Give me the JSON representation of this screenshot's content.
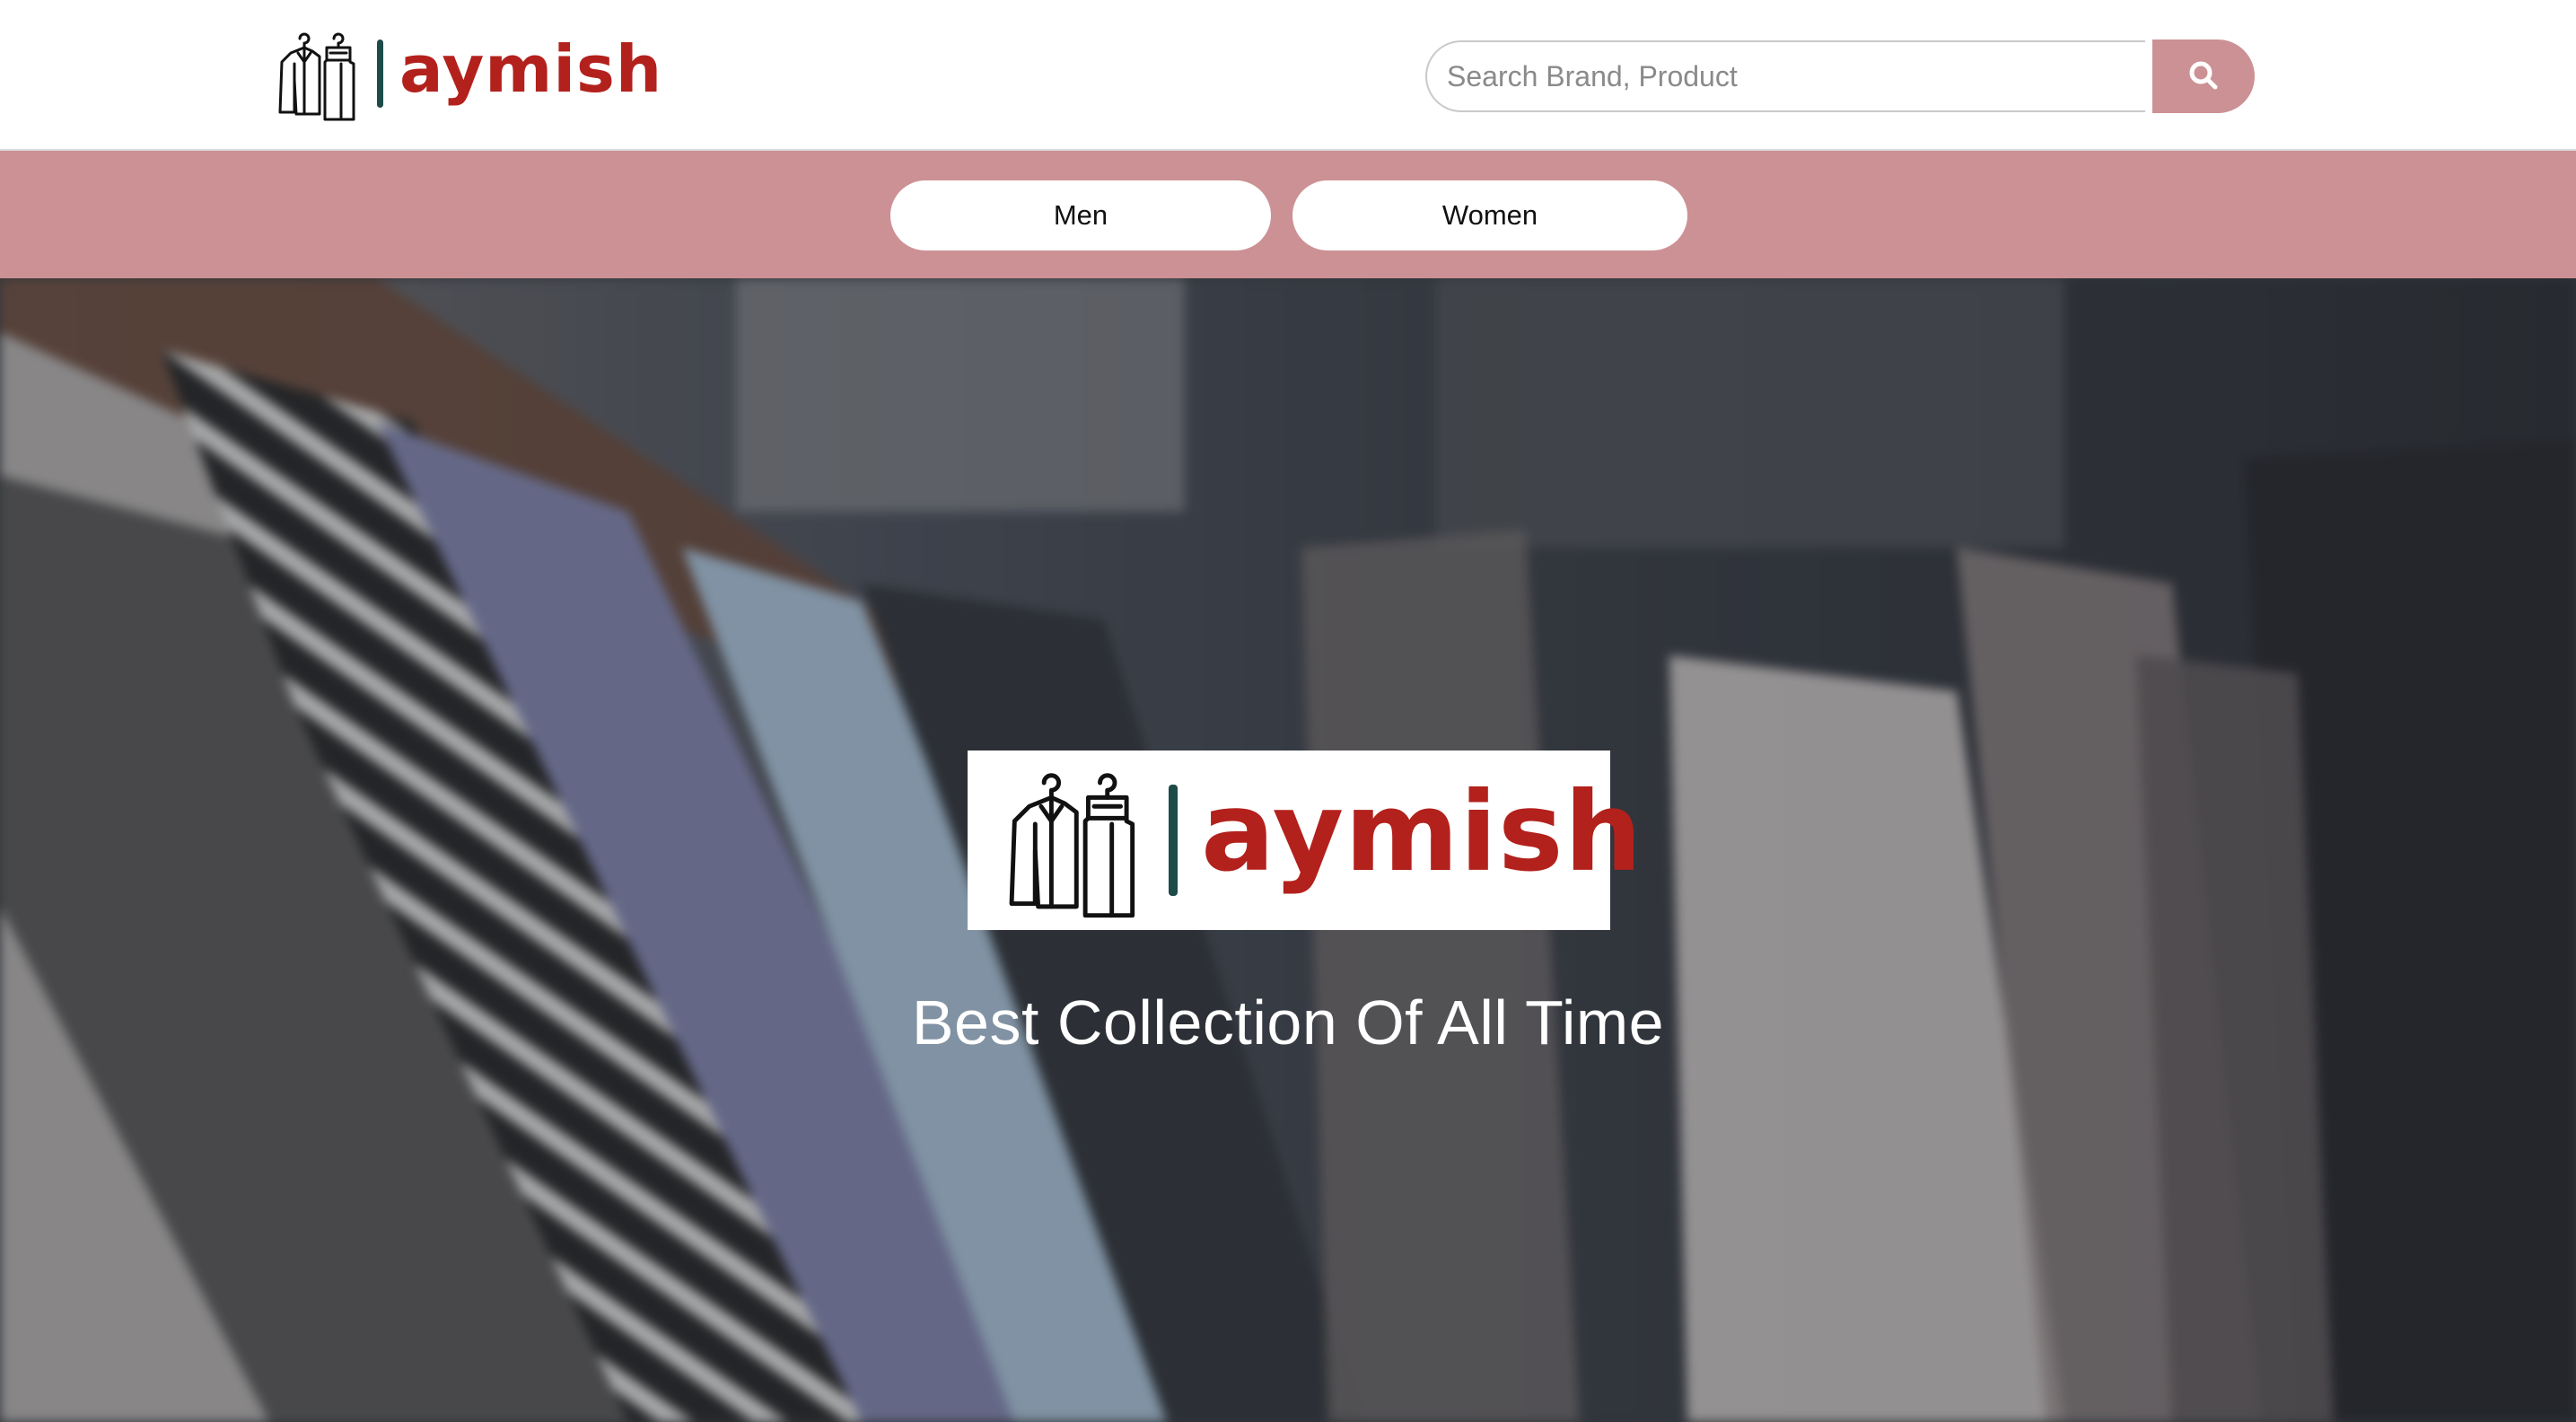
{
  "brand": {
    "name": "aymish",
    "text_color": "#b3211c",
    "divider_color": "#1e4a48",
    "icon": "clothes-hanger-icon"
  },
  "search": {
    "placeholder": "Search Brand, Product",
    "value": "",
    "button_icon": "search-icon"
  },
  "nav": {
    "background": "#cc9194",
    "items": [
      {
        "label": "Men"
      },
      {
        "label": "Women"
      }
    ]
  },
  "hero": {
    "tagline": "Best Collection Of All Time"
  },
  "colors": {
    "accent": "#cc9194",
    "header_bg": "#ffffff"
  }
}
